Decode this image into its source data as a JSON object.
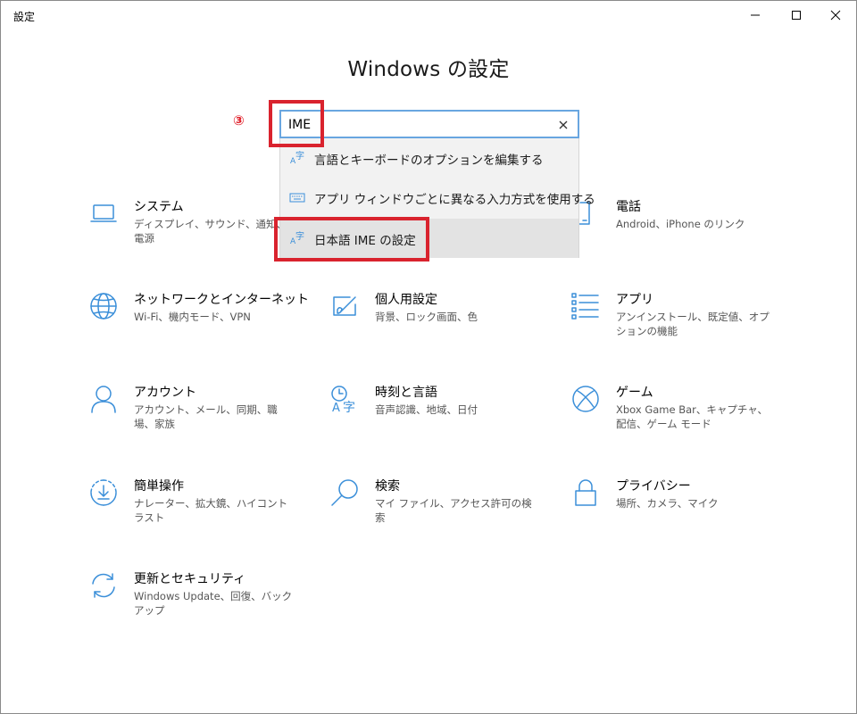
{
  "window": {
    "title": "設定",
    "min_label": "minimize",
    "max_label": "maximize",
    "close_label": "close"
  },
  "page_title": "Windows の設定",
  "annotation_number": "③",
  "search": {
    "value": "IME",
    "placeholder": "",
    "suggestions": [
      {
        "label": "言語とキーボードのオプションを編集する",
        "icon": "language-icon"
      },
      {
        "label": "アプリ ウィンドウごとに異なる入力方式を使用する",
        "icon": "keyboard-icon"
      },
      {
        "label": "日本語 IME の設定",
        "icon": "language-icon"
      }
    ]
  },
  "tiles": {
    "system": {
      "title": "システム",
      "desc": "ディスプレイ、サウンド、通知、電源",
      "icon": "laptop-icon"
    },
    "phone": {
      "title": "電話",
      "desc": "Android、iPhone のリンク",
      "icon": "phone-icon"
    },
    "network": {
      "title": "ネットワークとインターネット",
      "desc": "Wi-Fi、機内モード、VPN",
      "icon": "globe-icon"
    },
    "personalization": {
      "title": "個人用設定",
      "desc": "背景、ロック画面、色",
      "icon": "paint-icon"
    },
    "apps": {
      "title": "アプリ",
      "desc": "アンインストール、既定値、オプションの機能",
      "icon": "apps-list-icon"
    },
    "accounts": {
      "title": "アカウント",
      "desc": "アカウント、メール、同期、職場、家族",
      "icon": "person-icon"
    },
    "time_language": {
      "title": "時刻と言語",
      "desc": "音声認識、地域、日付",
      "icon": "time-language-icon"
    },
    "gaming": {
      "title": "ゲーム",
      "desc": "Xbox Game Bar、キャプチャ、配信、ゲーム モード",
      "icon": "xbox-icon"
    },
    "ease_of_access": {
      "title": "簡単操作",
      "desc": "ナレーター、拡大鏡、ハイコントラスト",
      "icon": "ease-of-access-icon"
    },
    "search": {
      "title": "検索",
      "desc": "マイ ファイル、アクセス許可の検索",
      "icon": "magnifier-icon"
    },
    "privacy": {
      "title": "プライバシー",
      "desc": "場所、カメラ、マイク",
      "icon": "lock-icon"
    },
    "update_security": {
      "title": "更新とセキュリティ",
      "desc": "Windows Update、回復、バックアップ",
      "icon": "sync-icon"
    }
  },
  "colors": {
    "accent": "#3b8fd9",
    "highlight": "#d9232e",
    "search_border": "#69a6e0"
  }
}
